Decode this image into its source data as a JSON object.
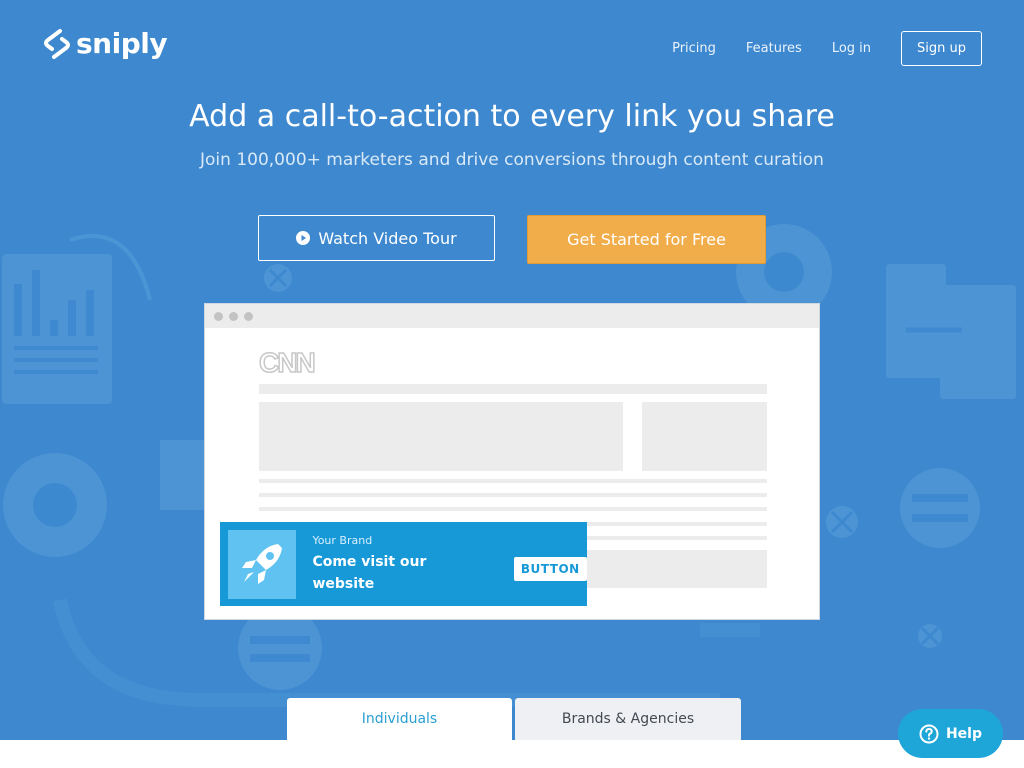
{
  "header": {
    "logo_text": "sniply",
    "nav": {
      "pricing": "Pricing",
      "features": "Features",
      "login": "Log in",
      "signup": "Sign up"
    }
  },
  "hero": {
    "headline": "Add a call-to-action to every link you share",
    "subheadline": "Join 100,000+ marketers and drive conversions through content curation",
    "watch_video_label": "Watch Video Tour",
    "get_started_label": "Get Started for Free"
  },
  "mockup": {
    "site_logo": "CNN",
    "snip": {
      "brand": "Your Brand",
      "message": "Come visit our website",
      "button": "BUTTON",
      "icon": "rocket-icon"
    }
  },
  "tabs": [
    {
      "label": "Individuals",
      "active": true
    },
    {
      "label": "Brands & Agencies",
      "active": false
    }
  ],
  "help": {
    "label": "Help",
    "icon": "question-icon"
  },
  "colors": {
    "hero_background": "#3d88cf",
    "cta_orange": "#f2ad4b",
    "snip_blue": "#1799d8",
    "help_blue": "#1ea6d9",
    "active_tab_text": "#2b9fd3"
  }
}
